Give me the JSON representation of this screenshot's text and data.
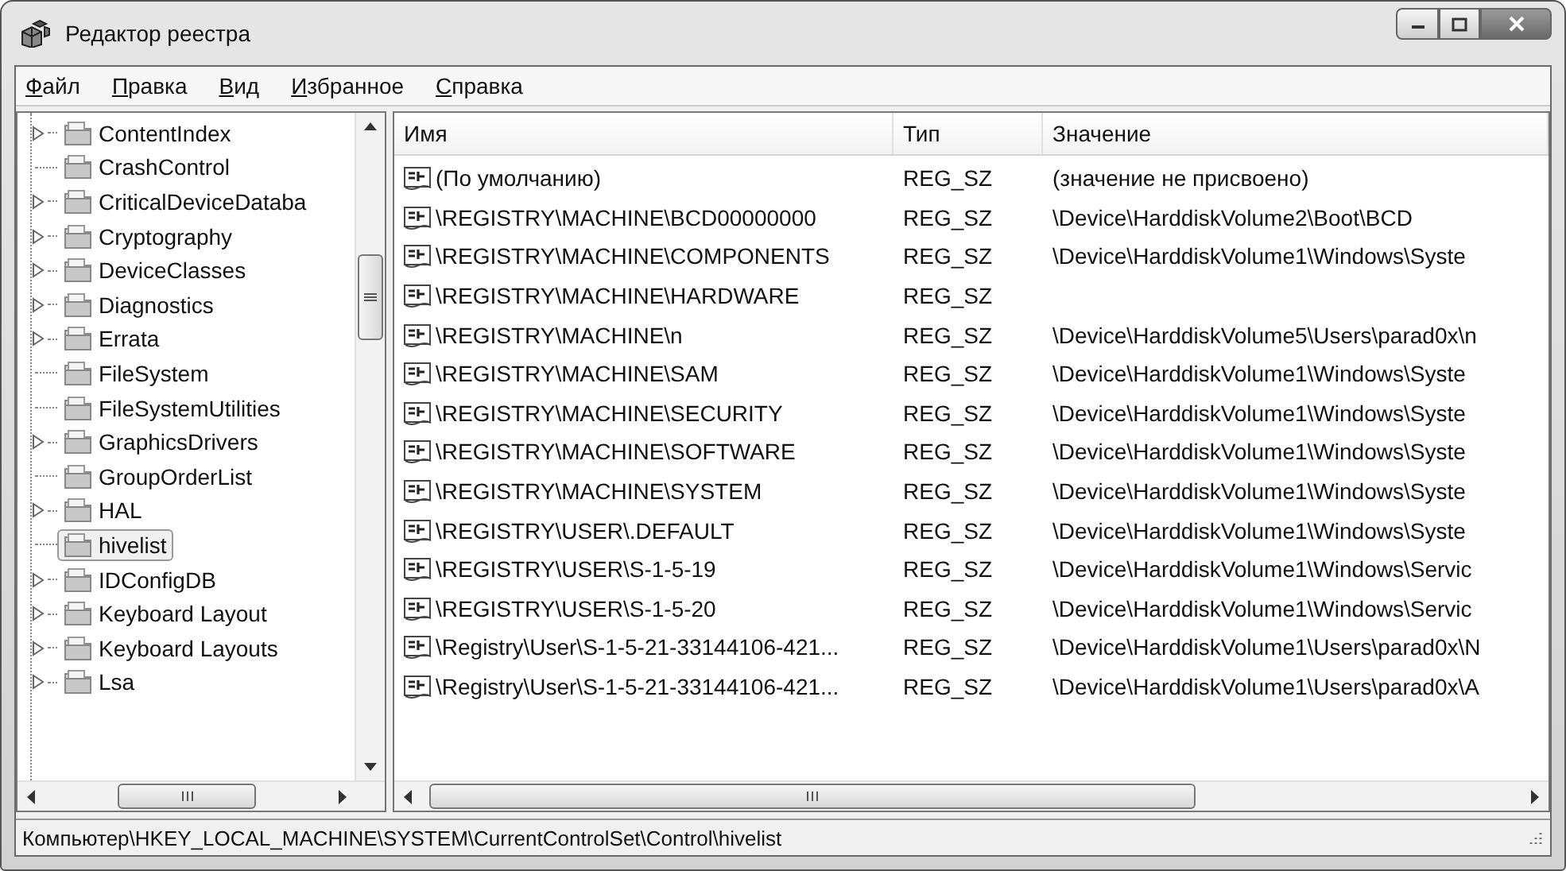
{
  "window": {
    "title": "Редактор реестра"
  },
  "menu": [
    "Файл",
    "Правка",
    "Вид",
    "Избранное",
    "Справка"
  ],
  "tree": {
    "items": [
      {
        "label": "ContentIndex",
        "expandable": true,
        "selected": false
      },
      {
        "label": "CrashControl",
        "expandable": false,
        "selected": false
      },
      {
        "label": "CriticalDeviceDataba",
        "expandable": true,
        "selected": false
      },
      {
        "label": "Cryptography",
        "expandable": true,
        "selected": false
      },
      {
        "label": "DeviceClasses",
        "expandable": true,
        "selected": false
      },
      {
        "label": "Diagnostics",
        "expandable": true,
        "selected": false
      },
      {
        "label": "Errata",
        "expandable": true,
        "selected": false
      },
      {
        "label": "FileSystem",
        "expandable": false,
        "selected": false
      },
      {
        "label": "FileSystemUtilities",
        "expandable": false,
        "selected": false
      },
      {
        "label": "GraphicsDrivers",
        "expandable": true,
        "selected": false
      },
      {
        "label": "GroupOrderList",
        "expandable": false,
        "selected": false
      },
      {
        "label": "HAL",
        "expandable": true,
        "selected": false
      },
      {
        "label": "hivelist",
        "expandable": false,
        "selected": true
      },
      {
        "label": "IDConfigDB",
        "expandable": true,
        "selected": false
      },
      {
        "label": "Keyboard Layout",
        "expandable": true,
        "selected": false
      },
      {
        "label": "Keyboard Layouts",
        "expandable": true,
        "selected": false
      },
      {
        "label": "Lsa",
        "expandable": true,
        "selected": false
      }
    ]
  },
  "table": {
    "columns": [
      "Имя",
      "Тип",
      "Значение"
    ],
    "rows": [
      {
        "name": "(По умолчанию)",
        "type": "REG_SZ",
        "value": "(значение не присвоено)"
      },
      {
        "name": "\\REGISTRY\\MACHINE\\BCD00000000",
        "type": "REG_SZ",
        "value": "\\Device\\HarddiskVolume2\\Boot\\BCD"
      },
      {
        "name": "\\REGISTRY\\MACHINE\\COMPONENTS",
        "type": "REG_SZ",
        "value": "\\Device\\HarddiskVolume1\\Windows\\Syste"
      },
      {
        "name": "\\REGISTRY\\MACHINE\\HARDWARE",
        "type": "REG_SZ"
      },
      {
        "name": "\\REGISTRY\\MACHINE\\n",
        "type": "REG_SZ",
        "value": "\\Device\\HarddiskVolume5\\Users\\parad0x\\n"
      },
      {
        "name": "\\REGISTRY\\MACHINE\\SAM",
        "type": "REG_SZ",
        "value": "\\Device\\HarddiskVolume1\\Windows\\Syste"
      },
      {
        "name": "\\REGISTRY\\MACHINE\\SECURITY",
        "type": "REG_SZ",
        "value": "\\Device\\HarddiskVolume1\\Windows\\Syste"
      },
      {
        "name": "\\REGISTRY\\MACHINE\\SOFTWARE",
        "type": "REG_SZ",
        "value": "\\Device\\HarddiskVolume1\\Windows\\Syste"
      },
      {
        "name": "\\REGISTRY\\MACHINE\\SYSTEM",
        "type": "REG_SZ",
        "value": "\\Device\\HarddiskVolume1\\Windows\\Syste"
      },
      {
        "name": "\\REGISTRY\\USER\\.DEFAULT",
        "type": "REG_SZ",
        "value": "\\Device\\HarddiskVolume1\\Windows\\Syste"
      },
      {
        "name": "\\REGISTRY\\USER\\S-1-5-19",
        "type": "REG_SZ",
        "value": "\\Device\\HarddiskVolume1\\Windows\\Servic"
      },
      {
        "name": "\\REGISTRY\\USER\\S-1-5-20",
        "type": "REG_SZ",
        "value": "\\Device\\HarddiskVolume1\\Windows\\Servic"
      },
      {
        "name": "\\Registry\\User\\S-1-5-21-33144106-421...",
        "type": "REG_SZ",
        "value": "\\Device\\HarddiskVolume1\\Users\\parad0x\\N"
      },
      {
        "name": "\\Registry\\User\\S-1-5-21-33144106-421...",
        "type": "REG_SZ",
        "value": "\\Device\\HarddiskVolume1\\Users\\parad0x\\A"
      }
    ]
  },
  "status_bar": "Компьютер\\HKEY_LOCAL_MACHINE\\SYSTEM\\CurrentControlSet\\Control\\hivelist"
}
